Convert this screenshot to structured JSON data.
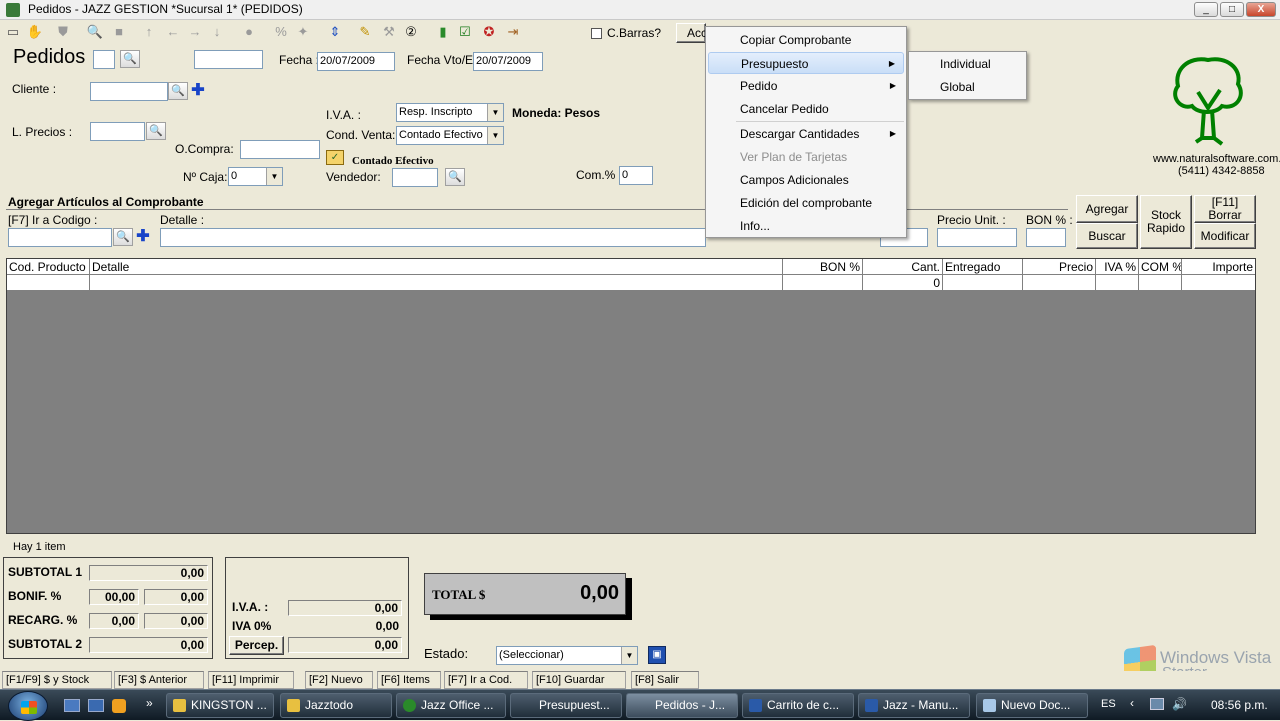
{
  "window": {
    "title": "Pedidos - JAZZ GESTION *Sucursal 1* (PEDIDOS)",
    "min": "_",
    "max": "□",
    "close": "X"
  },
  "toolbar": {
    "cbarras_label": "C.Barras?",
    "acciones_label": "Acc"
  },
  "header": {
    "title": "Pedidos",
    "fecha_label": "Fecha :",
    "fecha_value": "20/07/2009",
    "fecha_vto_label": "Fecha Vto/En",
    "fecha_vto_value": "20/07/2009",
    "cliente_label": "Cliente :",
    "lprecios_label": "L. Precios :",
    "ocompra_label": "O.Compra:",
    "ncaja_label": "Nº Caja:",
    "ncaja_value": "0",
    "iva_label": "I.V.A. :",
    "iva_value": "Resp. Inscripto",
    "moneda_label": "Moneda: Pesos",
    "condventa_label": "Cond. Venta:",
    "condventa_value": "Contado Efectivo",
    "contado_label": "Contado Efectivo",
    "vendedor_label": "Vendedor:",
    "com_label": "Com.% :",
    "com_value": "0"
  },
  "logo": {
    "url": "www.naturalsoftware.com.ar",
    "phone": "(5411) 4342-8858"
  },
  "articulos": {
    "section_title": "Agregar Artículos al Comprobante",
    "codigo_label": "[F7] Ir a Codigo :",
    "detalle_label": "Detalle :",
    "precio_label": "Precio Unit. :",
    "bon_label": "BON % :",
    "agregar": "Agregar",
    "buscar": "Buscar",
    "stock_rapido": "Stock Rapido",
    "borrar": "[F11] Borrar",
    "modificar": "Modificar"
  },
  "grid": {
    "columns": [
      "Cod. Producto",
      "Detalle",
      "BON %",
      "Cant.",
      "Entregado",
      "Precio",
      "IVA %",
      "COM %",
      "Importe"
    ],
    "rows": [
      [
        "",
        "",
        "",
        "0",
        "",
        "",
        "",
        "",
        ""
      ]
    ],
    "items_count": "Hay 1 item"
  },
  "totals": {
    "subtotal1_label": "SUBTOTAL 1",
    "subtotal1": "0,00",
    "bonif_label": "BONIF. %",
    "bonif_pct": "00,00",
    "bonif": "0,00",
    "recarg_label": "RECARG. %",
    "recarg_pct": "0,00",
    "recarg": "0,00",
    "subtotal2_label": "SUBTOTAL 2",
    "subtotal2": "0,00",
    "iva_label": "I.V.A. :",
    "iva": "0,00",
    "iva0_label": "IVA 0%",
    "iva0": "0,00",
    "percep_label": "Percep.",
    "percep": "0,00",
    "total_label": "TOTAL $",
    "total": "0,00",
    "estado_label": "Estado:",
    "estado_value": "(Seleccionar)"
  },
  "statusbar": [
    "[F1/F9] $ y Stock",
    "[F3] $ Anterior",
    "[F11] Imprimir",
    "[F2] Nuevo",
    "[F6] Items",
    "[F7] Ir a Cod.",
    "[F10] Guardar",
    "[F8] Salir"
  ],
  "menu": {
    "items": [
      {
        "label": "Copiar Comprobante",
        "submenu": false,
        "disabled": false
      },
      {
        "label": "Presupuesto",
        "submenu": true,
        "disabled": false
      },
      {
        "label": "Pedido",
        "submenu": true,
        "disabled": false
      },
      {
        "label": "Cancelar Pedido",
        "submenu": false,
        "disabled": false
      },
      {
        "label": "Descargar Cantidades",
        "submenu": true,
        "disabled": false
      },
      {
        "label": "Ver Plan de Tarjetas",
        "submenu": false,
        "disabled": true
      },
      {
        "label": "Campos Adicionales",
        "submenu": false,
        "disabled": false
      },
      {
        "label": "Edición del comprobante",
        "submenu": false,
        "disabled": false
      },
      {
        "label": "Info...",
        "submenu": false,
        "disabled": false
      }
    ],
    "submenu_items": [
      "Individual",
      "Global"
    ]
  },
  "watermark": {
    "line1": "Windows Vista",
    "line2": "Starter"
  },
  "taskbar": {
    "tasks": [
      "KINGSTON ...",
      "Jazztodo",
      "Jazz Office ...",
      "Presupuest...",
      "Pedidos - J...",
      "Carrito de c...",
      "Jazz - Manu...",
      "Nuevo Doc..."
    ],
    "lang": "ES",
    "clock": "08:56 p.m."
  },
  "colors": {
    "accent": "#008000",
    "grid_bg": "#808080",
    "taskbar": "#1b2731"
  }
}
